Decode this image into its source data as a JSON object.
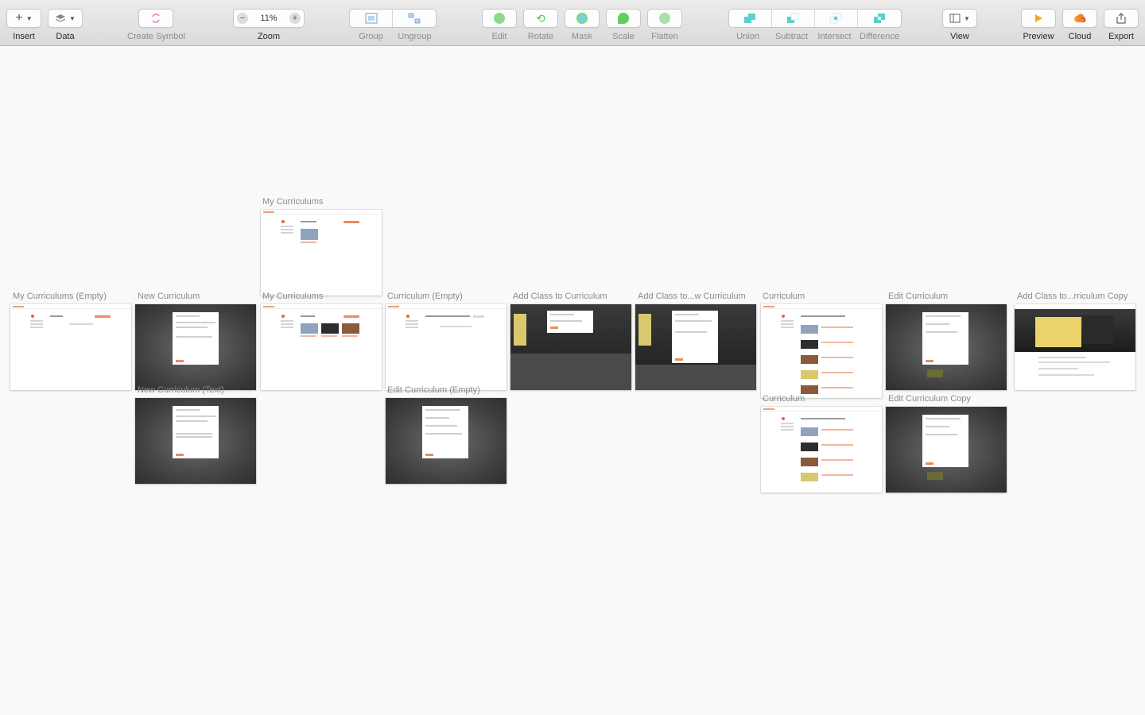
{
  "toolbar": {
    "insert": "Insert",
    "data": "Data",
    "create_symbol": "Create Symbol",
    "zoom_label": "Zoom",
    "zoom_value": "11%",
    "zoom_minus": "−",
    "zoom_plus": "+",
    "group": "Group",
    "ungroup": "Ungroup",
    "edit": "Edit",
    "rotate": "Rotate",
    "mask": "Mask",
    "scale": "Scale",
    "flatten": "Flatten",
    "union": "Union",
    "subtract": "Subtract",
    "intersect": "Intersect",
    "difference": "Difference",
    "view": "View",
    "preview": "Preview",
    "cloud": "Cloud",
    "export": "Export"
  },
  "artboards": {
    "my_curriculums_top": "My Curriculums",
    "my_curriculums_empty": "My Curriculums (Empty)",
    "new_curriculum": "New Curriculum",
    "my_curriculums": "My Curriculums",
    "curriculum_empty": "Curriculum (Empty)",
    "add_class_to_curriculum": "Add Class to Curriculum",
    "add_class_to_new_curriculum": "Add Class to...w Curriculum",
    "curriculum": "Curriculum",
    "edit_curriculum": "Edit Curriculum",
    "add_class_copy": "Add Class to...rriculum Copy",
    "new_curriculum_text": "New Curriculum (Text)",
    "edit_curriculum_empty": "Edit Curriculum (Empty)",
    "curriculum_2": "Curriculum",
    "edit_curriculum_copy": "Edit Curriculum Copy"
  },
  "colors": {
    "accent": "#ef8a5c",
    "dark_overlay": "#3e3e3e",
    "canvas": "#f9f9f9"
  },
  "icons": {
    "insert": "plus-icon",
    "data": "layers-icon",
    "create_symbol": "symbol-icon",
    "group": "group-icon",
    "ungroup": "ungroup-icon",
    "edit": "edit-shape-icon",
    "rotate": "rotate-icon",
    "mask": "mask-icon",
    "scale": "scale-icon",
    "flatten": "flatten-icon",
    "union": "union-icon",
    "subtract": "subtract-icon",
    "intersect": "intersect-icon",
    "difference": "difference-icon",
    "view": "view-icon",
    "preview": "play-icon",
    "cloud": "cloud-icon",
    "export": "share-icon"
  }
}
